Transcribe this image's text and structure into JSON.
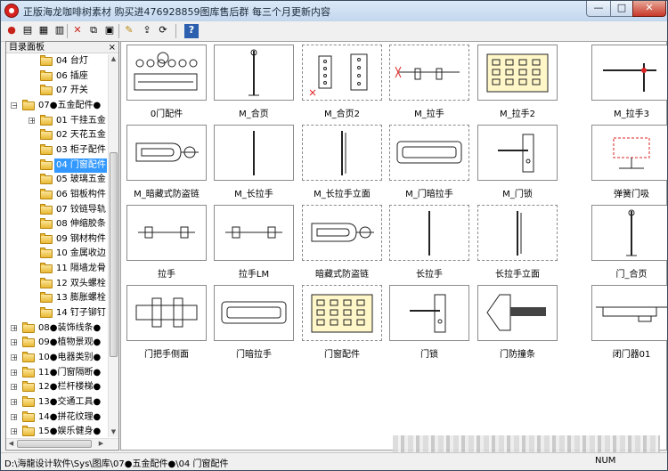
{
  "window": {
    "title": "正版海龙咖啡树素材 购买进476928859图库售后群 每三个月更新内容",
    "minimize_glyph": "—",
    "maximize_glyph": "□",
    "close_glyph": "✕"
  },
  "toolbar": {
    "buttons": [
      {
        "name": "app-icon-button",
        "glyph": "●"
      },
      {
        "name": "open-button",
        "glyph": "▤"
      },
      {
        "name": "list-button",
        "glyph": "▦"
      },
      {
        "name": "details-button",
        "glyph": "▥"
      },
      {
        "name": "delete-button",
        "glyph": "✕"
      },
      {
        "name": "copy-button",
        "glyph": "⧉"
      },
      {
        "name": "paste-button",
        "glyph": "▣"
      },
      {
        "name": "edit-button",
        "glyph": "✎"
      },
      {
        "name": "export-button",
        "glyph": "⇪"
      },
      {
        "name": "refresh-button",
        "glyph": "⟳"
      },
      {
        "name": "help-button",
        "glyph": "?"
      }
    ]
  },
  "tree": {
    "header": "目录面板",
    "close_glyph": "×",
    "items": [
      {
        "label": "04 台灯",
        "level": 2,
        "expander": ""
      },
      {
        "label": "06 插座",
        "level": 2,
        "expander": ""
      },
      {
        "label": "07 开关",
        "level": 2,
        "expander": ""
      },
      {
        "label": "07●五金配件●",
        "level": 1,
        "expander": "−"
      },
      {
        "label": "01 干挂五金",
        "level": 2,
        "expander": "+"
      },
      {
        "label": "02 天花五金",
        "level": 2,
        "expander": ""
      },
      {
        "label": "03 柜子配件",
        "level": 2,
        "expander": ""
      },
      {
        "label": "04 门窗配件",
        "level": 2,
        "expander": "",
        "selected": true
      },
      {
        "label": "05 玻璃五金",
        "level": 2,
        "expander": ""
      },
      {
        "label": "06 钼板构件",
        "level": 2,
        "expander": ""
      },
      {
        "label": "07 铰链导轨",
        "level": 2,
        "expander": ""
      },
      {
        "label": "08 伸缩胶条",
        "level": 2,
        "expander": ""
      },
      {
        "label": "09 钢材构件",
        "level": 2,
        "expander": ""
      },
      {
        "label": "10 金属收边",
        "level": 2,
        "expander": ""
      },
      {
        "label": "11 隔墙龙骨",
        "level": 2,
        "expander": ""
      },
      {
        "label": "12 双头螺栓",
        "level": 2,
        "expander": ""
      },
      {
        "label": "13 膨胀螺栓",
        "level": 2,
        "expander": ""
      },
      {
        "label": "14 钉子铆钉",
        "level": 2,
        "expander": ""
      },
      {
        "label": "08●装饰线条●",
        "level": 1,
        "expander": "+"
      },
      {
        "label": "09●植物景观●",
        "level": 1,
        "expander": "+"
      },
      {
        "label": "10●电器类别●",
        "level": 1,
        "expander": "+"
      },
      {
        "label": "11●门窗隔断●",
        "level": 1,
        "expander": "+"
      },
      {
        "label": "12●栏杆楼梯●",
        "level": 1,
        "expander": "+"
      },
      {
        "label": "13●交通工具●",
        "level": 1,
        "expander": "+"
      },
      {
        "label": "14●拼花纹理●",
        "level": 1,
        "expander": "+"
      },
      {
        "label": "15●娱乐健身●",
        "level": 1,
        "expander": "+"
      }
    ]
  },
  "thumbnails": [
    {
      "label": "0门配件",
      "icon": "door-parts"
    },
    {
      "label": "M_合页",
      "icon": "hinge"
    },
    {
      "label": "M_合页2",
      "icon": "hinge-2"
    },
    {
      "label": "M_拉手",
      "icon": "pull-handle"
    },
    {
      "label": "M_拉手2",
      "icon": "pull-handle-2"
    },
    {
      "label": "M_拉手3",
      "icon": "pull-handle-3"
    },
    {
      "label": "M_暗藏式防盗链",
      "icon": "hidden-chain"
    },
    {
      "label": "M_长拉手",
      "icon": "long-handle"
    },
    {
      "label": "M_长拉手立面",
      "icon": "long-handle-elevation"
    },
    {
      "label": "M_门暗拉手",
      "icon": "recessed-handle"
    },
    {
      "label": "M_门锁",
      "icon": "door-lock"
    },
    {
      "label": "弹簧门吸",
      "icon": "spring-stopper"
    },
    {
      "label": "拉手",
      "icon": "handle"
    },
    {
      "label": "拉手LM",
      "icon": "handle-lm"
    },
    {
      "label": "暗藏式防盗链",
      "icon": "hidden-chain-2"
    },
    {
      "label": "长拉手",
      "icon": "long-handle-2"
    },
    {
      "label": "长拉手立面",
      "icon": "long-handle-elevation-2"
    },
    {
      "label": "门_合页",
      "icon": "door-hinge"
    },
    {
      "label": "门把手侧面",
      "icon": "knob-side"
    },
    {
      "label": "门暗拉手",
      "icon": "recessed-handle-2"
    },
    {
      "label": "门窗配件",
      "icon": "door-window-parts"
    },
    {
      "label": "门锁",
      "icon": "lock"
    },
    {
      "label": "门防撞条",
      "icon": "bumper-strip"
    },
    {
      "label": "闭门器01",
      "icon": "door-closer"
    }
  ],
  "status": {
    "path": "D:\\海龍设计软件\\Sys\\图库\\07●五金配件●\\04 门窗配件",
    "num": "NUM"
  }
}
